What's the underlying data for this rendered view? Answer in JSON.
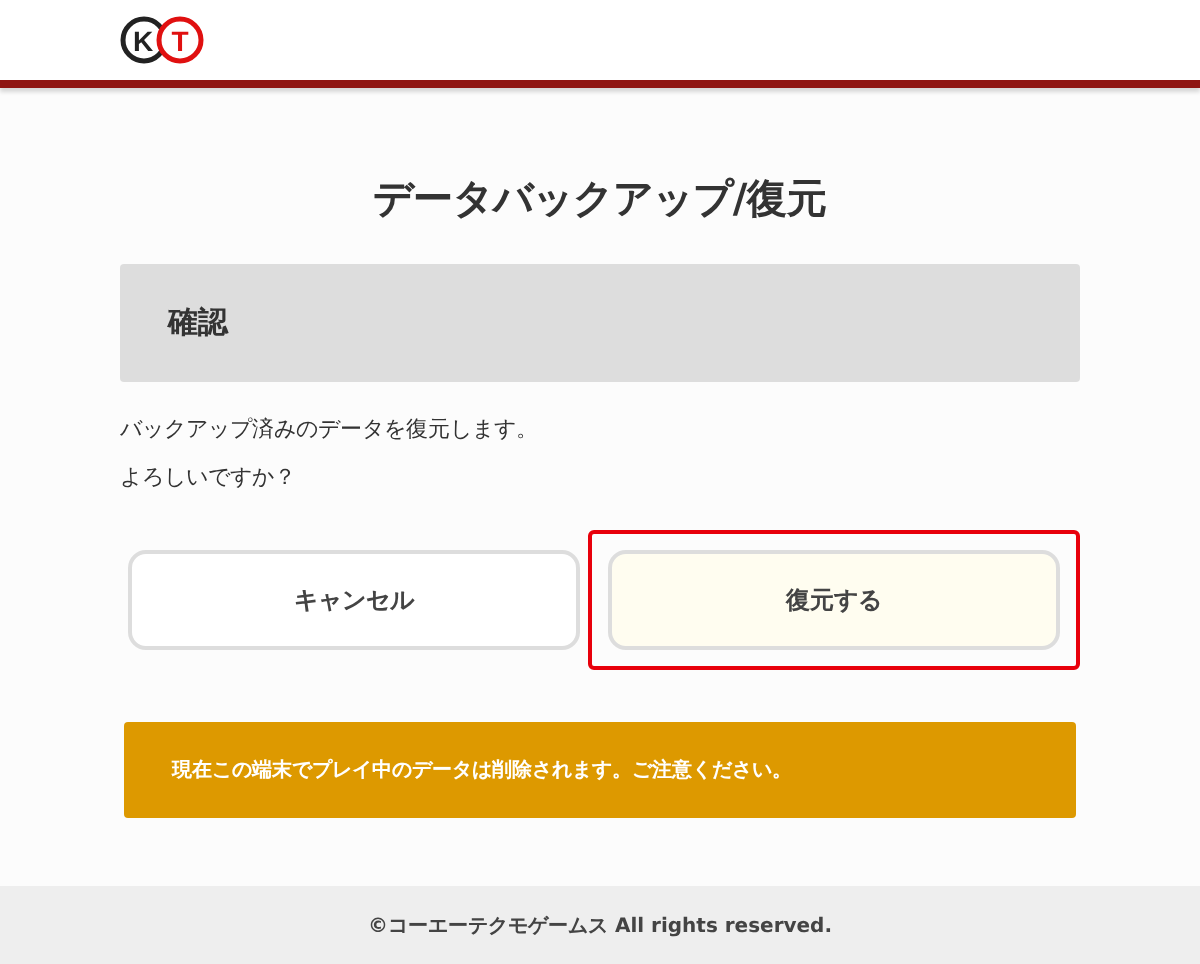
{
  "header": {
    "logo": {
      "left": "K",
      "right": "T"
    }
  },
  "title": "データバックアップ/復元",
  "section": {
    "heading": "確認"
  },
  "message": [
    "バックアップ済みのデータを復元します。",
    "よろしいですか？"
  ],
  "buttons": [
    {
      "label": "キャンセル",
      "kind": "plain",
      "highlighted": false
    },
    {
      "label": "復元する",
      "kind": "primary",
      "highlighted": true
    }
  ],
  "warning": "現在この端末でプレイ中のデータは削除されます。ご注意ください。",
  "footer": "©コーエーテクモゲームス All rights reserved."
}
